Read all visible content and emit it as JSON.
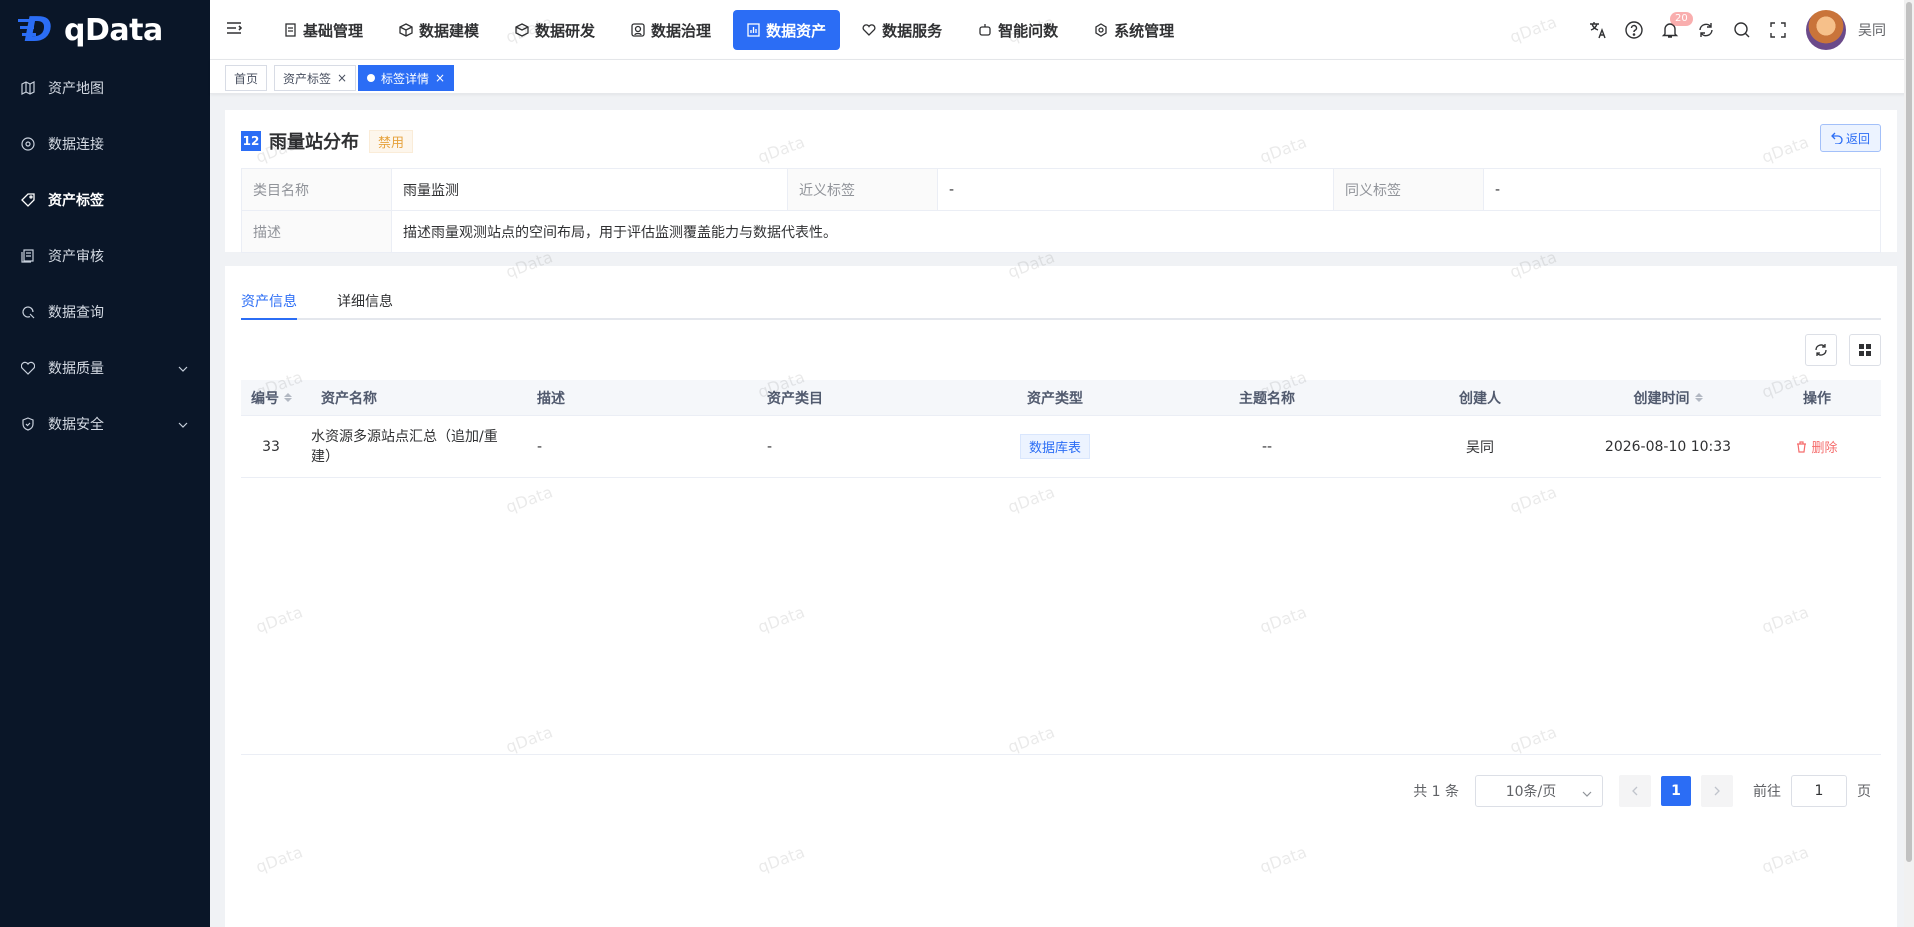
{
  "app": {
    "name": "qData",
    "watermark": "qData"
  },
  "sidebar": {
    "items": [
      {
        "label": "资产地图",
        "icon": "map-icon"
      },
      {
        "label": "数据连接",
        "icon": "connection-icon"
      },
      {
        "label": "资产标签",
        "icon": "tag-icon",
        "active": true
      },
      {
        "label": "资产审核",
        "icon": "audit-icon"
      },
      {
        "label": "数据查询",
        "icon": "query-icon"
      },
      {
        "label": "数据质量",
        "icon": "quality-icon",
        "expandable": true
      },
      {
        "label": "数据安全",
        "icon": "shield-icon",
        "expandable": true
      }
    ]
  },
  "topnav": {
    "items": [
      {
        "label": "基础管理"
      },
      {
        "label": "数据建模"
      },
      {
        "label": "数据研发"
      },
      {
        "label": "数据治理"
      },
      {
        "label": "数据资产",
        "active": true
      },
      {
        "label": "数据服务"
      },
      {
        "label": "智能问数"
      },
      {
        "label": "系统管理"
      }
    ],
    "notification_count": "20",
    "username": "吴同"
  },
  "tabs": {
    "items": [
      {
        "label": "首页"
      },
      {
        "label": "资产标签",
        "closable": true
      },
      {
        "label": "标签详情",
        "closable": true,
        "active": true
      }
    ]
  },
  "detail": {
    "id": "12",
    "title": "雨量站分布",
    "status": "禁用",
    "back_label": "返回",
    "fields": {
      "category_label": "类目名称",
      "category_value": "雨量监测",
      "near_label": "近义标签",
      "near_value": "-",
      "synonym_label": "同义标签",
      "synonym_value": "-",
      "desc_label": "描述",
      "desc_value": "描述雨量观测站点的空间布局，用于评估监测覆盖能力与数据代表性。"
    }
  },
  "assets": {
    "tabs": [
      "资产信息",
      "详细信息"
    ],
    "columns": [
      "编号",
      "资产名称",
      "描述",
      "资产类目",
      "资产类型",
      "主题名称",
      "创建人",
      "创建时间",
      "操作"
    ],
    "rows": [
      {
        "id": "33",
        "name": "水资源多源站点汇总（追加/重建）",
        "desc": "-",
        "category": "-",
        "type": "数据库表",
        "theme": "--",
        "creator": "吴同",
        "created_at": "2026-08-10 10:33",
        "action": "删除"
      }
    ]
  },
  "pagination": {
    "total_text": "共 1 条",
    "page_size": "10条/页",
    "current_page": "1",
    "goto_label": "前往",
    "goto_value": "1",
    "page_suffix": "页"
  },
  "colors": {
    "primary": "#2b6df5",
    "sidebar_bg": "#0a1628",
    "danger": "#f56c6c",
    "warning": "#e6a23c"
  }
}
